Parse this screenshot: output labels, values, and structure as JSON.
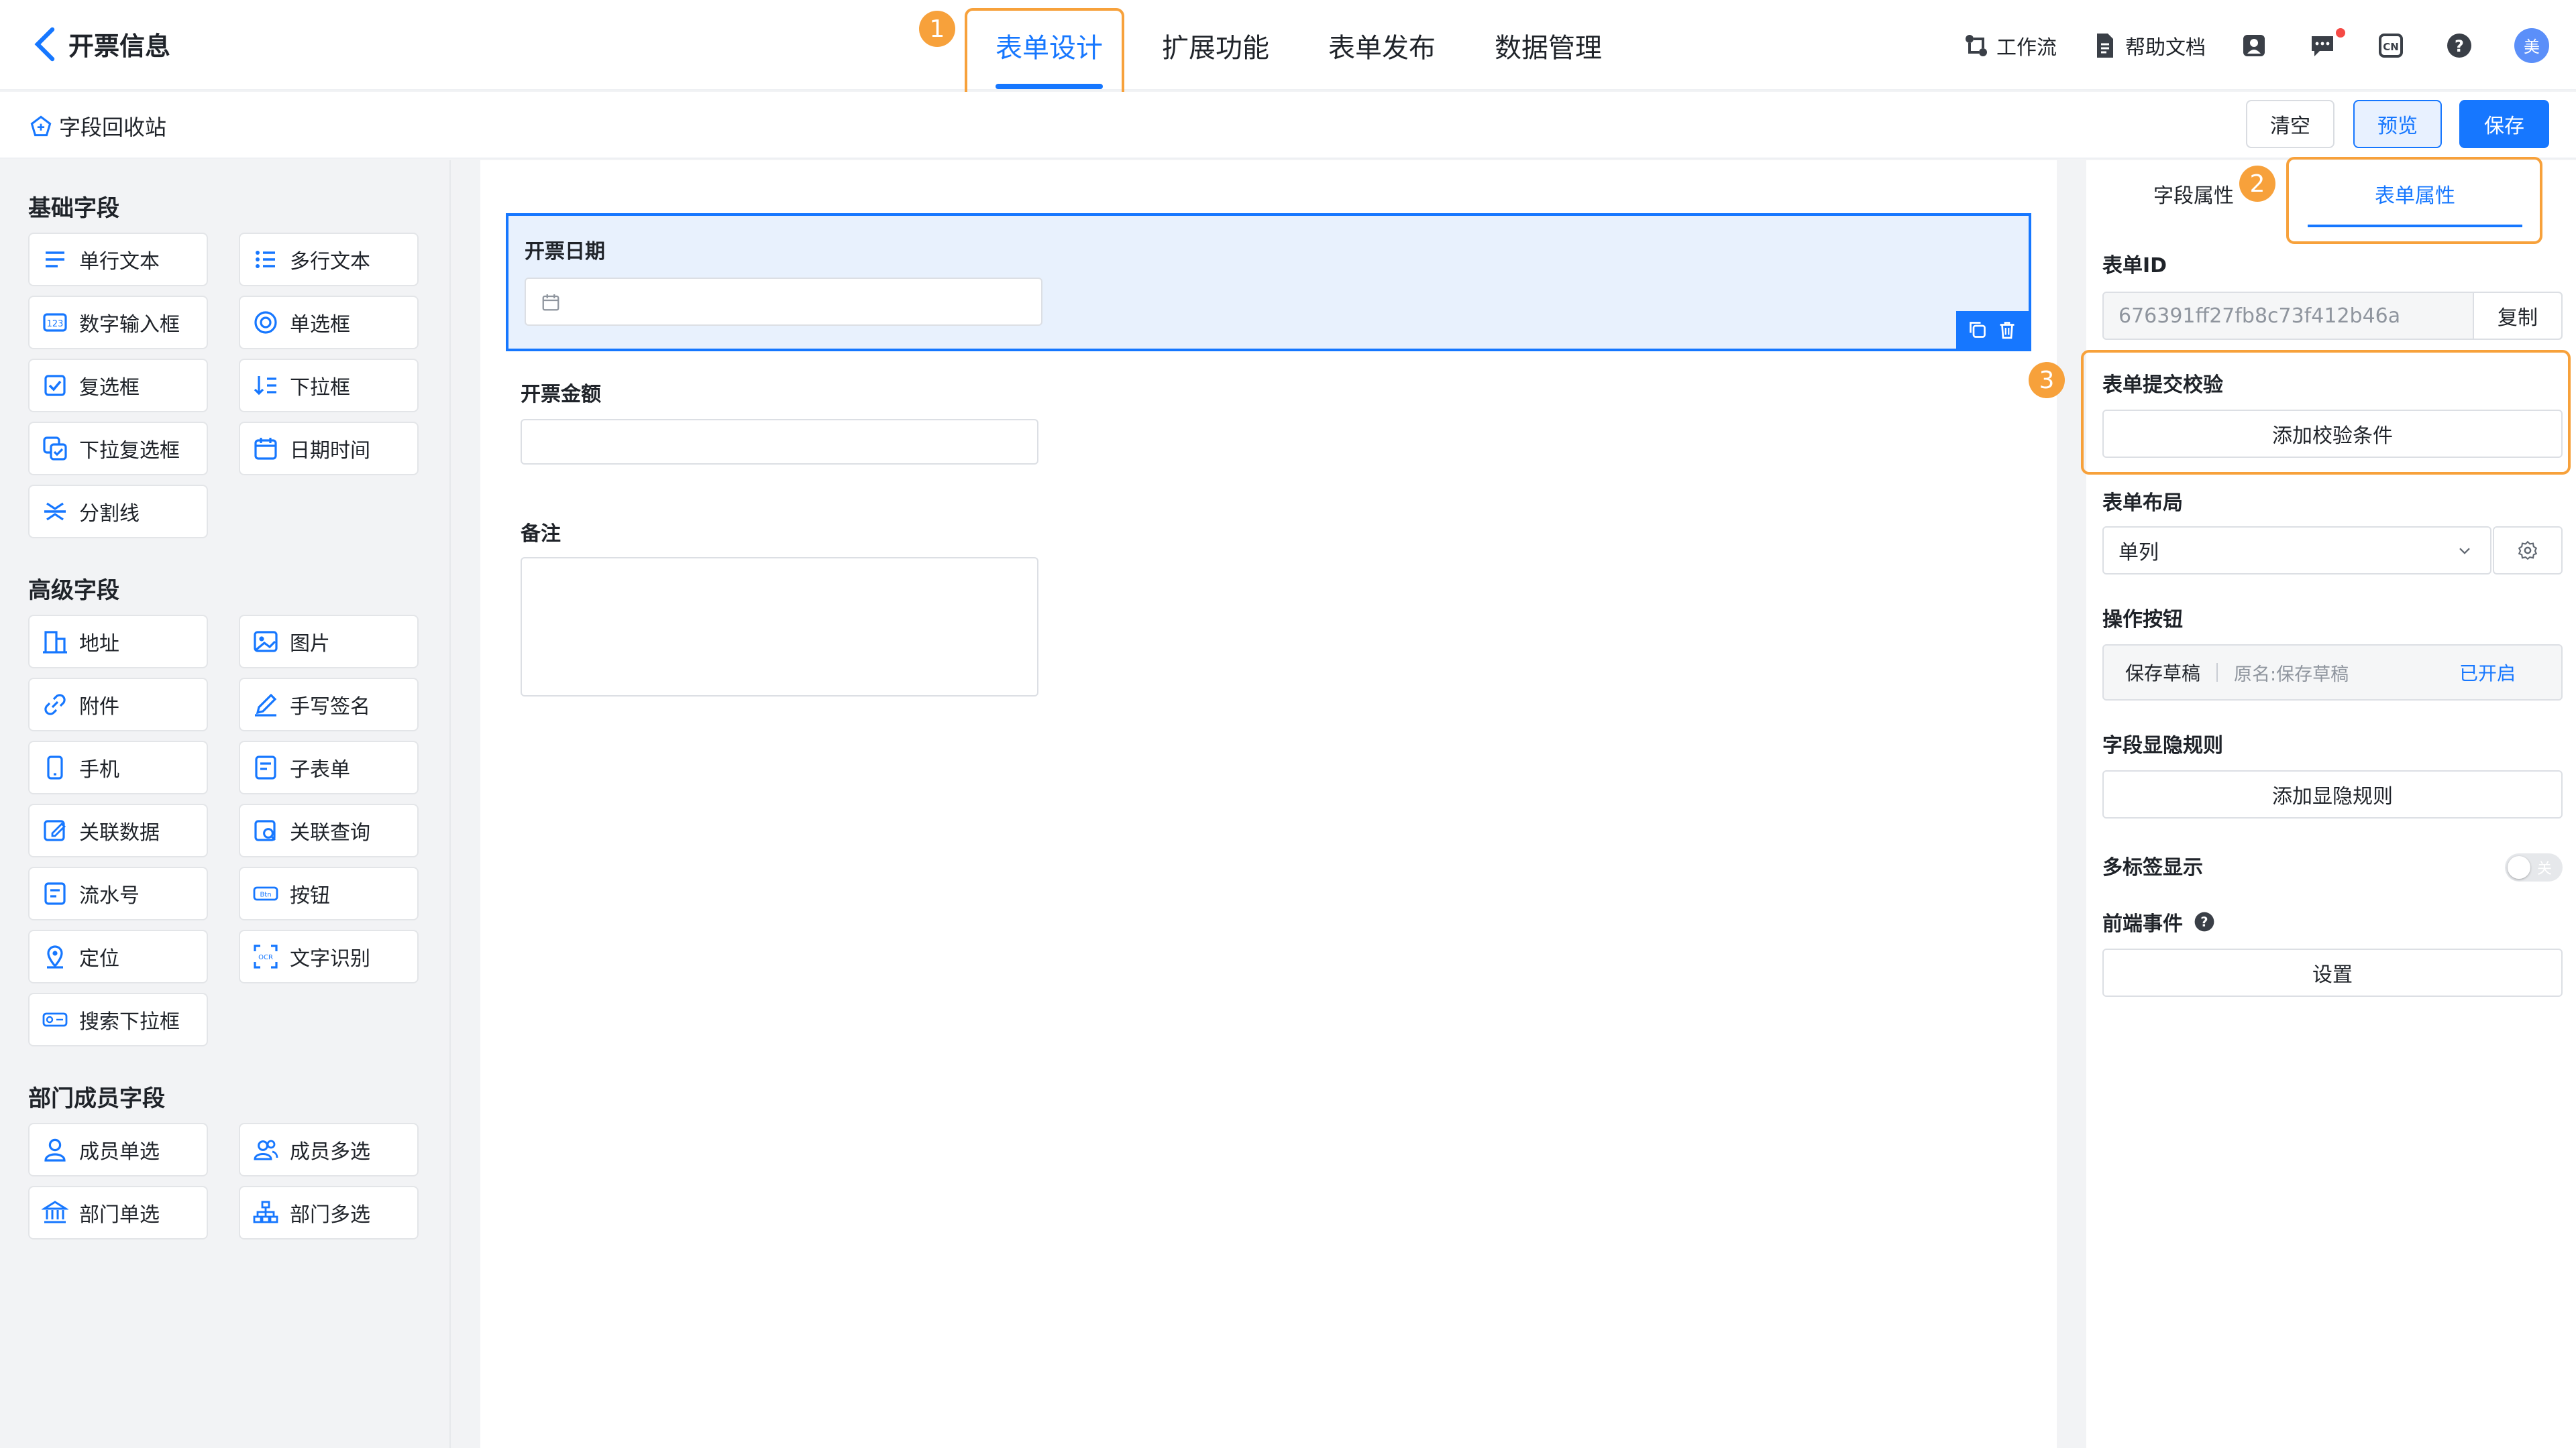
{
  "header": {
    "back_title": "开票信息",
    "nav": [
      {
        "label": "表单设计",
        "active": true
      },
      {
        "label": "扩展功能"
      },
      {
        "label": "表单发布"
      },
      {
        "label": "数据管理"
      }
    ],
    "tools": {
      "workflow": "工作流",
      "help_docs": "帮助文档",
      "lang": "CN",
      "help": "?",
      "avatar": "美"
    }
  },
  "subbar": {
    "recycle": "字段回收站",
    "clear": "清空",
    "preview": "预览",
    "save": "保存"
  },
  "badges": [
    "1",
    "2",
    "3"
  ],
  "left": {
    "groups": [
      {
        "title": "基础字段",
        "items": [
          "单行文本",
          "多行文本",
          "数字输入框",
          "单选框",
          "复选框",
          "下拉框",
          "下拉复选框",
          "日期时间",
          "分割线"
        ]
      },
      {
        "title": "高级字段",
        "items": [
          "地址",
          "图片",
          "附件",
          "手写签名",
          "手机",
          "子表单",
          "关联数据",
          "关联查询",
          "流水号",
          "按钮",
          "定位",
          "文字识别",
          "搜索下拉框"
        ]
      },
      {
        "title": "部门成员字段",
        "items": [
          "成员单选",
          "成员多选",
          "部门单选",
          "部门多选"
        ]
      }
    ]
  },
  "canvas": {
    "fields": [
      {
        "label": "开票日期"
      },
      {
        "label": "开票金额"
      },
      {
        "label": "备注"
      }
    ]
  },
  "right": {
    "tab_field": "字段属性",
    "tab_form": "表单属性",
    "form_id_label": "表单ID",
    "form_id_value": "676391ff27fb8c73f412b46a",
    "copy": "复制",
    "validate_label": "表单提交校验",
    "validate_btn": "添加校验条件",
    "layout_label": "表单布局",
    "layout_value": "单列",
    "actions_label": "操作按钮",
    "action_name": "保存草稿",
    "action_orig": "原名:保存草稿",
    "action_status": "已开启",
    "visibility_label": "字段显隐规则",
    "visibility_btn": "添加显隐规则",
    "multitab_label": "多标签显示",
    "multitab_toggle": "关",
    "events_label": "前端事件",
    "events_btn": "设置"
  },
  "colors": {
    "accent": "#1677ff",
    "highlight": "#f7a13b"
  }
}
